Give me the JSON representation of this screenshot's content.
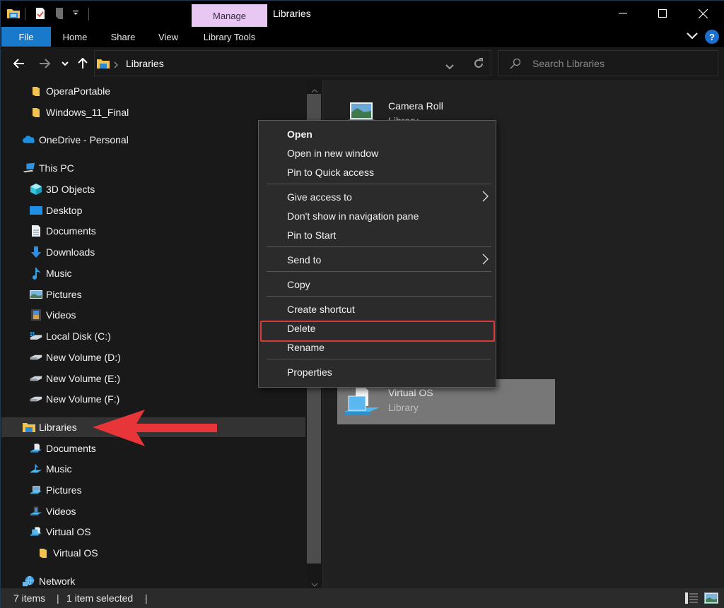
{
  "window": {
    "title": "Libraries",
    "contextual_tab_group": "Manage",
    "controls": {
      "minimize": "minimize",
      "maximize": "maximize",
      "close": "close"
    }
  },
  "quick_access_toolbar": {
    "icons": [
      "file-explorer-icon",
      "properties-icon",
      "new-folder-icon",
      "customize-dropdown-icon"
    ]
  },
  "ribbon": {
    "tabs": [
      {
        "label": "File",
        "active": true
      },
      {
        "label": "Home"
      },
      {
        "label": "Share"
      },
      {
        "label": "View"
      },
      {
        "label": "Library Tools"
      }
    ],
    "help_label": "?"
  },
  "address_bar": {
    "breadcrumb": [
      "Libraries"
    ],
    "search_placeholder": "Search Libraries"
  },
  "nav_pane": {
    "items": [
      {
        "label": "OperaPortable",
        "icon": "folder-icon",
        "level": 2
      },
      {
        "label": "Windows_11_Final",
        "icon": "folder-icon",
        "level": 2
      },
      {
        "label": "OneDrive - Personal",
        "icon": "onedrive-cloud-icon",
        "level": 1
      },
      {
        "label": "This PC",
        "icon": "computer-icon",
        "level": 1
      },
      {
        "label": "3D Objects",
        "icon": "3d-objects-icon",
        "level": 2
      },
      {
        "label": "Desktop",
        "icon": "desktop-icon",
        "level": 2
      },
      {
        "label": "Documents",
        "icon": "documents-icon",
        "level": 2
      },
      {
        "label": "Downloads",
        "icon": "downloads-icon",
        "level": 2
      },
      {
        "label": "Music",
        "icon": "music-icon",
        "level": 2
      },
      {
        "label": "Pictures",
        "icon": "pictures-icon",
        "level": 2
      },
      {
        "label": "Videos",
        "icon": "videos-icon",
        "level": 2
      },
      {
        "label": "Local Disk (C:)",
        "icon": "system-drive-icon",
        "level": 2
      },
      {
        "label": "New Volume (D:)",
        "icon": "drive-icon",
        "level": 2
      },
      {
        "label": "New Volume (E:)",
        "icon": "drive-icon",
        "level": 2
      },
      {
        "label": "New Volume (F:)",
        "icon": "drive-icon",
        "level": 2
      },
      {
        "label": "Libraries",
        "icon": "libraries-icon",
        "level": 1,
        "selected": true
      },
      {
        "label": "Documents",
        "icon": "library-documents-icon",
        "level": 2
      },
      {
        "label": "Music",
        "icon": "library-music-icon",
        "level": 2
      },
      {
        "label": "Pictures",
        "icon": "library-pictures-icon",
        "level": 2
      },
      {
        "label": "Videos",
        "icon": "library-videos-icon",
        "level": 2
      },
      {
        "label": "Virtual OS",
        "icon": "library-icon",
        "level": 2
      },
      {
        "label": "Virtual OS",
        "icon": "folder-icon",
        "level": 3
      },
      {
        "label": "Network",
        "icon": "network-icon",
        "level": 1
      }
    ]
  },
  "content": {
    "libraries": [
      {
        "name": "Camera Roll",
        "type": "Library",
        "selected": false
      },
      {
        "name": "Virtual OS",
        "type": "Library",
        "selected": true
      }
    ]
  },
  "context_menu": {
    "items": [
      {
        "label": "Open",
        "bold": true
      },
      {
        "label": "Open in new window"
      },
      {
        "label": "Pin to Quick access"
      },
      {
        "separator": true
      },
      {
        "label": "Give access to",
        "submenu": true
      },
      {
        "label": "Don't show in navigation pane"
      },
      {
        "label": "Pin to Start"
      },
      {
        "separator": true
      },
      {
        "label": "Send to",
        "submenu": true
      },
      {
        "separator": true
      },
      {
        "label": "Copy"
      },
      {
        "separator": true
      },
      {
        "label": "Create shortcut"
      },
      {
        "label": "Delete",
        "highlighted": true
      },
      {
        "label": "Rename"
      },
      {
        "separator": true
      },
      {
        "label": "Properties"
      }
    ]
  },
  "status_bar": {
    "item_count": "7 items",
    "selection": "1 item selected"
  },
  "colors": {
    "accent_file_tab": "#1979ca",
    "manage_tab": "#e8c8f2",
    "highlight_border": "#d93a3a",
    "annotation_arrow": "#e8353a"
  }
}
